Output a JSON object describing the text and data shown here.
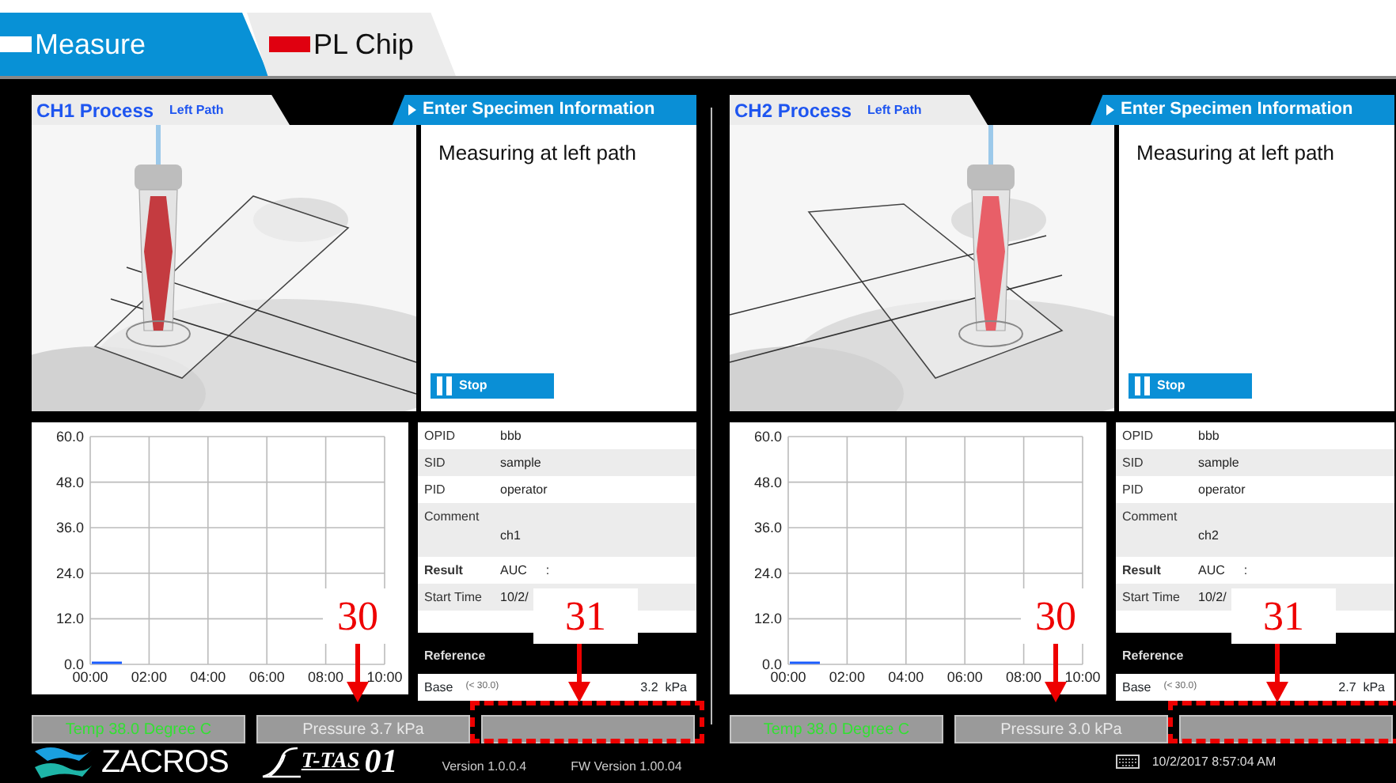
{
  "tabs": [
    {
      "label": "Measure",
      "selected": true
    },
    {
      "label": "PL Chip",
      "selected": false
    }
  ],
  "channels": [
    {
      "title": "CH1 Process",
      "path": "Left Path",
      "action": "Enter Specimen Information",
      "message": "Measuring at left path",
      "stop_button": "Stop",
      "chart_data": {
        "type": "line",
        "grid": true,
        "xlim": [
          0,
          10
        ],
        "ylim": [
          0,
          60
        ],
        "xticks": [
          {
            "value": 0,
            "label": "00:00"
          },
          {
            "value": 2,
            "label": "02:00"
          },
          {
            "value": 4,
            "label": "04:00"
          },
          {
            "value": 6,
            "label": "06:00"
          },
          {
            "value": 8,
            "label": "08:00"
          },
          {
            "value": 10,
            "label": "10:00"
          }
        ],
        "yticks": [
          {
            "value": 0,
            "label": "0.0"
          },
          {
            "value": 12,
            "label": "12.0"
          },
          {
            "value": 24,
            "label": "24.0"
          },
          {
            "value": 36,
            "label": "36.0"
          },
          {
            "value": 48,
            "label": "48.0"
          },
          {
            "value": 60,
            "label": "60.0"
          }
        ]
      },
      "info": [
        {
          "kind": "plain",
          "label": "OPID",
          "value": "bbb"
        },
        {
          "kind": "plain",
          "label": "SID",
          "value": "sample"
        },
        {
          "kind": "plain",
          "label": "PID",
          "value": "operator"
        },
        {
          "kind": "tall",
          "label": "Comment",
          "value": "ch1"
        },
        {
          "kind": "result",
          "label": "Result",
          "value": "AUC",
          "extra": ":"
        },
        {
          "kind": "plain",
          "label": "Start Time",
          "value": "10/2/"
        }
      ],
      "reference_label": "Reference",
      "base": {
        "label": "Base",
        "range": "(<  30.0)",
        "value": "3.2",
        "unit": "kPa"
      },
      "status": {
        "temperature": "Temp 38.0 Degree C",
        "pressure": "Pressure 3.7 kPa"
      },
      "callouts": [
        {
          "kind": "pressure",
          "number": "30"
        },
        {
          "kind": "status",
          "number": "31"
        }
      ]
    },
    {
      "title": "CH2 Process",
      "path": "Left Path",
      "action": "Enter Specimen Information",
      "message": "Measuring at left path",
      "stop_button": "Stop",
      "chart_data": {
        "type": "line",
        "grid": true,
        "xlim": [
          0,
          10
        ],
        "ylim": [
          0,
          60
        ],
        "xticks": [
          {
            "value": 0,
            "label": "00:00"
          },
          {
            "value": 2,
            "label": "02:00"
          },
          {
            "value": 4,
            "label": "04:00"
          },
          {
            "value": 6,
            "label": "06:00"
          },
          {
            "value": 8,
            "label": "08:00"
          },
          {
            "value": 10,
            "label": "10:00"
          }
        ],
        "yticks": [
          {
            "value": 0,
            "label": "0.0"
          },
          {
            "value": 12,
            "label": "12.0"
          },
          {
            "value": 24,
            "label": "24.0"
          },
          {
            "value": 36,
            "label": "36.0"
          },
          {
            "value": 48,
            "label": "48.0"
          },
          {
            "value": 60,
            "label": "60.0"
          }
        ]
      },
      "info": [
        {
          "kind": "plain",
          "label": "OPID",
          "value": "bbb"
        },
        {
          "kind": "plain",
          "label": "SID",
          "value": "sample"
        },
        {
          "kind": "plain",
          "label": "PID",
          "value": "operator"
        },
        {
          "kind": "tall",
          "label": "Comment",
          "value": "ch2"
        },
        {
          "kind": "result",
          "label": "Result",
          "value": "AUC",
          "extra": ":"
        },
        {
          "kind": "plain",
          "label": "Start Time",
          "value": "10/2/"
        }
      ],
      "reference_label": "Reference",
      "base": {
        "label": "Base",
        "range": "(<  30.0)",
        "value": "2.7",
        "unit": "kPa"
      },
      "status": {
        "temperature": "Temp 38.0 Degree C",
        "pressure": "Pressure 3.0 kPa"
      },
      "callouts": [
        {
          "kind": "pressure",
          "number": "30"
        },
        {
          "kind": "status",
          "number": "31"
        }
      ]
    }
  ],
  "footer": {
    "brand": "ZACROS",
    "product": "T-TAS",
    "product_number": "01",
    "version": "Version 1.0.0.4",
    "fw_version": "FW Version 1.00.04",
    "datetime": "10/2/2017 8:57:04 AM"
  }
}
